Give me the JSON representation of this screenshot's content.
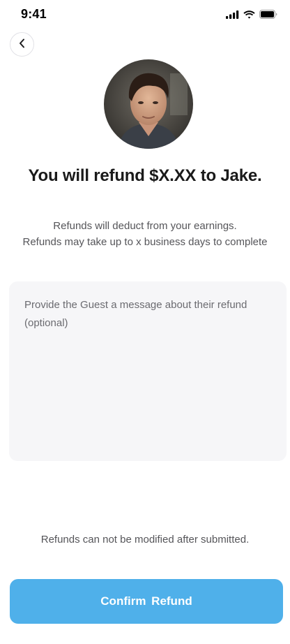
{
  "status_bar": {
    "time": "9:41",
    "icons": [
      "cellular-signal-icon",
      "wifi-icon",
      "battery-icon"
    ]
  },
  "header": {
    "back_icon": "chevron-left-icon"
  },
  "recipient": {
    "name": "Jake",
    "avatar": "profile-photo"
  },
  "title": "You will refund $X.XX to Jake.",
  "info": {
    "line1": "Refunds will deduct from your earnings.",
    "line2": "Refunds may take up to x business days to complete"
  },
  "message": {
    "value": "",
    "placeholder": "Provide the Guest a message about their refund (optional)"
  },
  "footnote": "Refunds can not be modified after submitted.",
  "confirm": {
    "label": "Confirm  Refund"
  },
  "colors": {
    "accent": "#4fb0ea",
    "input_background": "#f6f6f8",
    "body_text": "#555559"
  }
}
